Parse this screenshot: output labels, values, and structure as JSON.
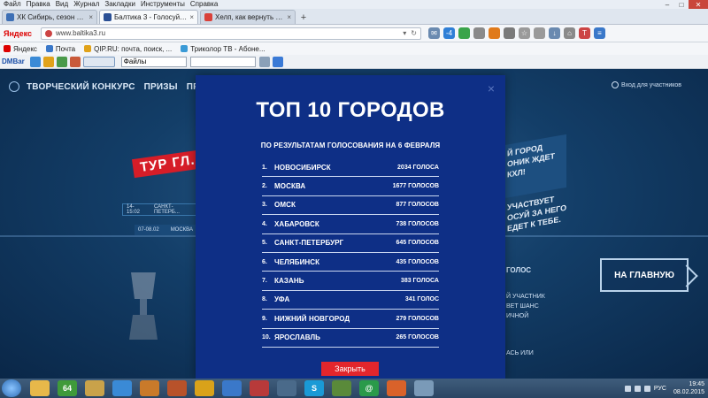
{
  "browser": {
    "menu": [
      "Файл",
      "Правка",
      "Вид",
      "Журнал",
      "Закладки",
      "Инструменты",
      "Справка"
    ],
    "tabs": [
      {
        "title": "ХК Сибирь, сезон 2014-20...",
        "color": "#3d6fb5",
        "active": false
      },
      {
        "title": "Балтика 3 - Голосуй за свой г...",
        "color": "#2a4f95",
        "active": true
      },
      {
        "title": "Хелп, как вернуть правил...",
        "color": "#d9413a",
        "active": false
      }
    ],
    "new_tab": "+",
    "brand": "Яндекс",
    "url": "www.baltika3.ru",
    "weather": "-4",
    "bookmarks": [
      "Яндекс",
      "Почта",
      "QIP.RU: почта, поиск, ...",
      "Триколор ТВ - Абоне..."
    ],
    "dmbar": {
      "logo": "DMBar",
      "files_label": "Файлы",
      "search_value": ""
    }
  },
  "site": {
    "nav": [
      "ТВОРЧЕСКИЙ КОНКУРС",
      "ПРИЗЫ",
      "ПРАВИЛА",
      "("
    ],
    "login": "Вход для участников",
    "banner": "ТУР ГЛ...",
    "match1": {
      "time": "14-15:02",
      "team": "САНКТ-ПЕТЕРБ..."
    },
    "match2": {
      "date": "07-08.02",
      "team": "МОСКВА"
    },
    "board_lines": [
      "Й ГОРОД",
      "ОНИК ЖДЕТ",
      "КХЛ!"
    ],
    "board2_lines": [
      "УЧАСТВУЕТ",
      "ОСУЙ ЗА НЕГО",
      "ЕДЕТ К ТЕБЕ."
    ],
    "home_button": "НА ГЛАВНУЮ",
    "side_title": "ГОЛОС",
    "side_lines": [
      "Й УЧАСТНИК",
      "ВЕТ ШАНС",
      "ИЧНОЙ"
    ],
    "side_bottom": "АСЬ ИЛИ"
  },
  "modal": {
    "title": "ТОП 10 ГОРОДОВ",
    "subtitle": "ПО РЕЗУЛЬТАТАМ ГОЛОСОВАНИЯ НА 6 ФЕВРАЛЯ",
    "close_x": "×",
    "close_button": "Закрыть",
    "ranking": [
      {
        "num": "1.",
        "city": "НОВОСИБИРСК",
        "votes": "2034 ГОЛОСА"
      },
      {
        "num": "2.",
        "city": "МОСКВА",
        "votes": "1677 ГОЛОСОВ"
      },
      {
        "num": "3.",
        "city": "ОМСК",
        "votes": "877 ГОЛОСОВ"
      },
      {
        "num": "4.",
        "city": "ХАБАРОВСК",
        "votes": "738 ГОЛОСОВ"
      },
      {
        "num": "5.",
        "city": "САНКТ-ПЕТЕРБУРГ",
        "votes": "645 ГОЛОСОВ"
      },
      {
        "num": "6.",
        "city": "ЧЕЛЯБИНСК",
        "votes": "435 ГОЛОСОВ"
      },
      {
        "num": "7.",
        "city": "КАЗАНЬ",
        "votes": "383 ГОЛОСА"
      },
      {
        "num": "8.",
        "city": "УФА",
        "votes": "341 ГОЛОС"
      },
      {
        "num": "9.",
        "city": "НИЖНИЙ НОВГОРОД",
        "votes": "279 ГОЛОСОВ"
      },
      {
        "num": "10.",
        "city": "ЯРОСЛАВЛЬ",
        "votes": "265 ГОЛОСОВ"
      }
    ]
  },
  "taskbar": {
    "icons": [
      {
        "name": "folder",
        "color": "#e7b84a",
        "label": ""
      },
      {
        "name": "app-64",
        "color": "#3f9a3a",
        "label": "64"
      },
      {
        "name": "paint",
        "color": "#c9a24a",
        "label": ""
      },
      {
        "name": "globe",
        "color": "#3a8ad6",
        "label": ""
      },
      {
        "name": "app-ball",
        "color": "#c97a2a",
        "label": ""
      },
      {
        "name": "pen",
        "color": "#b8522a",
        "label": ""
      },
      {
        "name": "aimp",
        "color": "#d9a21a",
        "label": ""
      },
      {
        "name": "chart",
        "color": "#3a78c9",
        "label": ""
      },
      {
        "name": "books",
        "color": "#b83a3a",
        "label": ""
      },
      {
        "name": "monitor",
        "color": "#4a6a8a",
        "label": ""
      },
      {
        "name": "skype",
        "color": "#1a9ad6",
        "label": "S"
      },
      {
        "name": "game",
        "color": "#5a8a3a",
        "label": ""
      },
      {
        "name": "qip",
        "color": "#2a9a4a",
        "label": "@"
      },
      {
        "name": "firefox",
        "color": "#d9622a",
        "label": ""
      },
      {
        "name": "notepad",
        "color": "#7a9ab8",
        "label": ""
      }
    ],
    "lang": "РУС",
    "time": "19:45",
    "date": "08.02.2015"
  }
}
